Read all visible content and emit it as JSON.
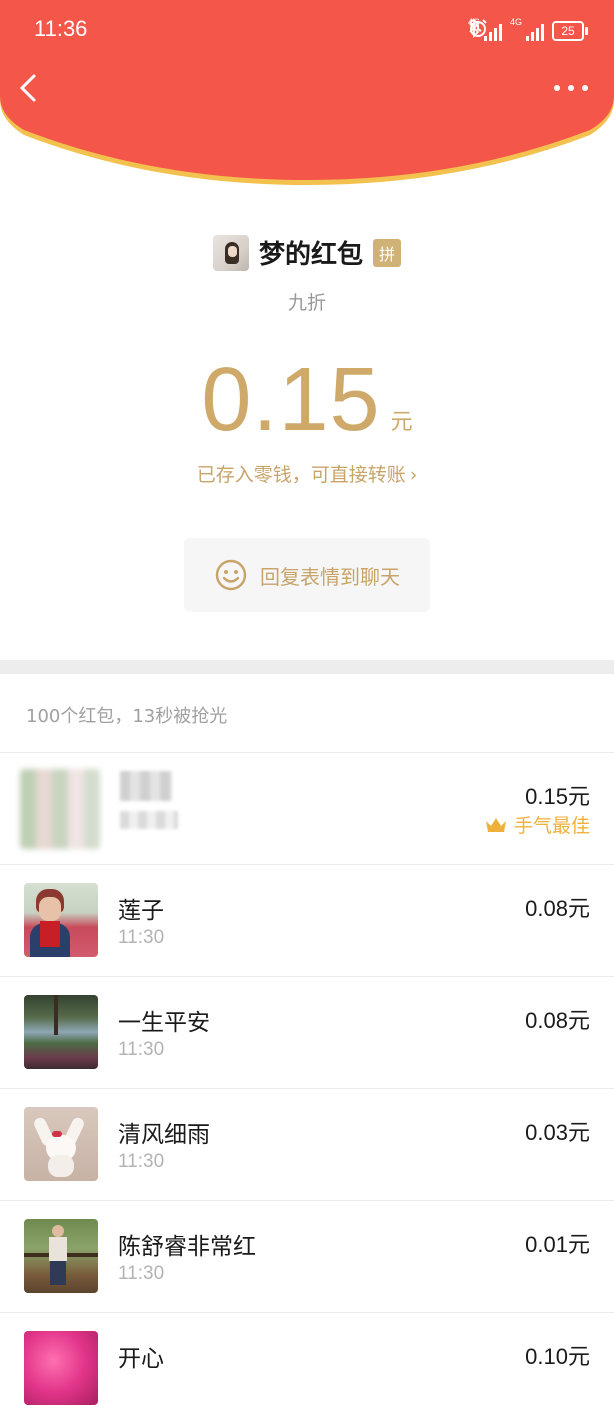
{
  "status_bar": {
    "time": "11:36",
    "battery": "25",
    "net_label_1": "4G",
    "net_label_2": "4G"
  },
  "header": {
    "background_color": "#f4564a",
    "accent_curve_color": "#f2c14e"
  },
  "sender": {
    "name": "梦的红包",
    "badge": "拼"
  },
  "subtitle": "九折",
  "amount": {
    "value": "0.15",
    "unit": "元"
  },
  "stored_note": {
    "text": "已存入零钱，可直接转账",
    "chevron": "›"
  },
  "reply_button": {
    "label": "回复表情到聊天"
  },
  "summary": "100个红包，13秒被抢光",
  "receivers": [
    {
      "name": "",
      "time": "",
      "amount": "0.15元",
      "best": "手气最佳",
      "avatar": "blurred"
    },
    {
      "name": "莲子",
      "time": "11:30",
      "amount": "0.08元",
      "avatar": "woman-red-scarf-flowers"
    },
    {
      "name": "一生平安",
      "time": "11:30",
      "amount": "0.08元",
      "avatar": "park-lake"
    },
    {
      "name": "清风细雨",
      "time": "11:30",
      "amount": "0.03元",
      "avatar": "white-rabbit"
    },
    {
      "name": "陈舒睿非常红",
      "time": "11:30",
      "amount": "0.01元",
      "avatar": "person-outdoor"
    },
    {
      "name": "开心",
      "time": "",
      "amount": "0.10元",
      "avatar": "pink-flowers"
    }
  ],
  "colors": {
    "gold": "#cfa96a",
    "best_orange": "#f0b13b",
    "divider": "#ededed"
  }
}
